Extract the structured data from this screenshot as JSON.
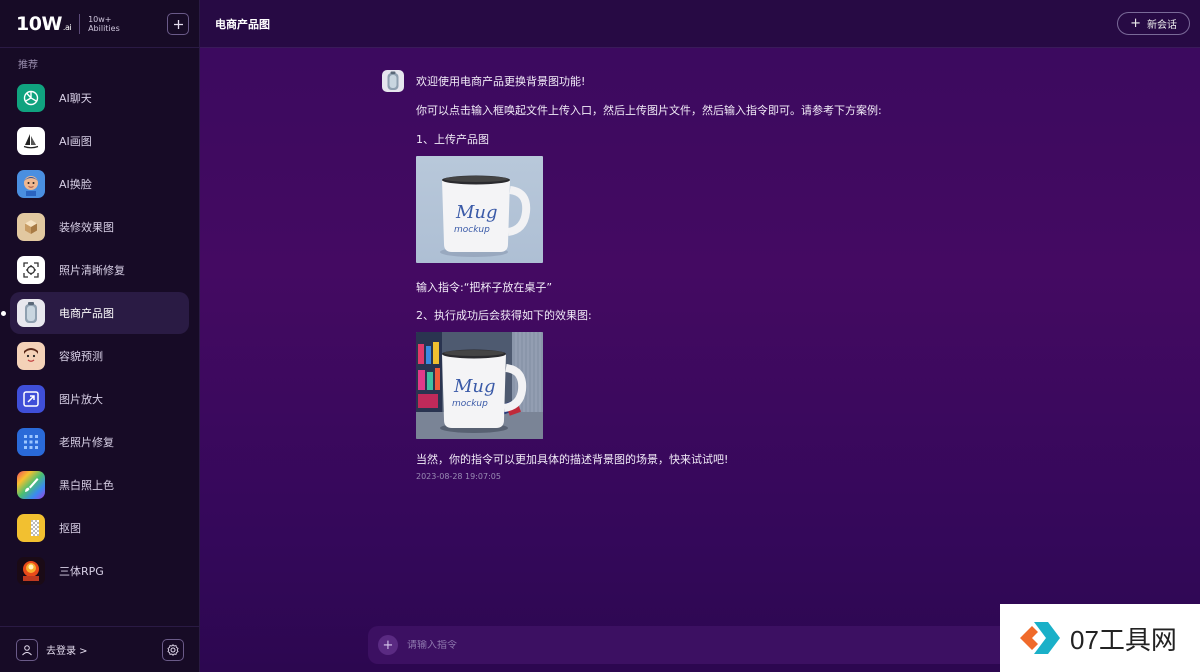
{
  "brand": {
    "logo": "10W",
    "logo_sub": ".ai",
    "tagline_1": "10w+",
    "tagline_2": "Abilities"
  },
  "sidebar": {
    "section_label": "推荐",
    "items": [
      {
        "label": "AI聊天",
        "icon": "chatgpt-icon"
      },
      {
        "label": "AI画图",
        "icon": "sailboat-icon"
      },
      {
        "label": "AI换脸",
        "icon": "face-avatar-icon"
      },
      {
        "label": "装修效果图",
        "icon": "cube-icon"
      },
      {
        "label": "照片清晰修复",
        "icon": "focus-scan-icon"
      },
      {
        "label": "电商产品图",
        "icon": "product-bottle-icon",
        "active": true
      },
      {
        "label": "容貌预测",
        "icon": "face-cartoon-icon"
      },
      {
        "label": "图片放大",
        "icon": "expand-icon"
      },
      {
        "label": "老照片修复",
        "icon": "grid-icon"
      },
      {
        "label": "黑白照上色",
        "icon": "paintbrush-icon"
      },
      {
        "label": "抠图",
        "icon": "transparent-icon"
      },
      {
        "label": "三体RPG",
        "icon": "explosion-icon"
      }
    ],
    "footer": {
      "login_label": "去登录 >"
    }
  },
  "topbar": {
    "title": "电商产品图",
    "new_chat_label": "新会话"
  },
  "message": {
    "line1": "欢迎使用电商产品更换背景图功能!",
    "line2": "你可以点击输入框唤起文件上传入口，然后上传图片文件，然后输入指令即可。请参考下方案例:",
    "line3": "1、上传产品图",
    "line4": "输入指令:“把杯子放在桌子”",
    "line5": "2、执行成功后会获得如下的效果图:",
    "line6": "当然，你的指令可以更加具体的描述背景图的场景，快来试试吧!",
    "timestamp": "2023-08-28 19:07:05",
    "mug_text_1": "Mug",
    "mug_text_2": "mockup"
  },
  "input": {
    "placeholder": "请输入指令"
  },
  "watermark": {
    "text": "07工具网"
  },
  "colors": {
    "sidebar_bg": "#170b26",
    "main_bg": "#3a0a5e",
    "active_item_bg": "#2a1b44",
    "mug_text": "#3a5aa8"
  }
}
